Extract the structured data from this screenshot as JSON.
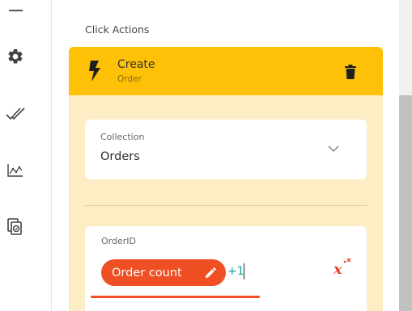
{
  "sidebar": {
    "items": [
      {
        "icon": "gear-icon"
      },
      {
        "icon": "double-check-icon"
      },
      {
        "icon": "chart-icon"
      },
      {
        "icon": "copy-settings-icon"
      }
    ]
  },
  "section": {
    "title": "Click Actions"
  },
  "action": {
    "name": "Create",
    "subtitle": "Order",
    "icon": "bolt-icon",
    "delete_icon": "trash-icon",
    "accent_color": "#ffc107"
  },
  "collection": {
    "label": "Collection",
    "value": "Orders"
  },
  "order_id": {
    "label": "OrderID",
    "chip_label": "Order count",
    "chip_color": "#f04e23",
    "expression_suffix": "+1",
    "formula_icon": "formula-icon"
  }
}
